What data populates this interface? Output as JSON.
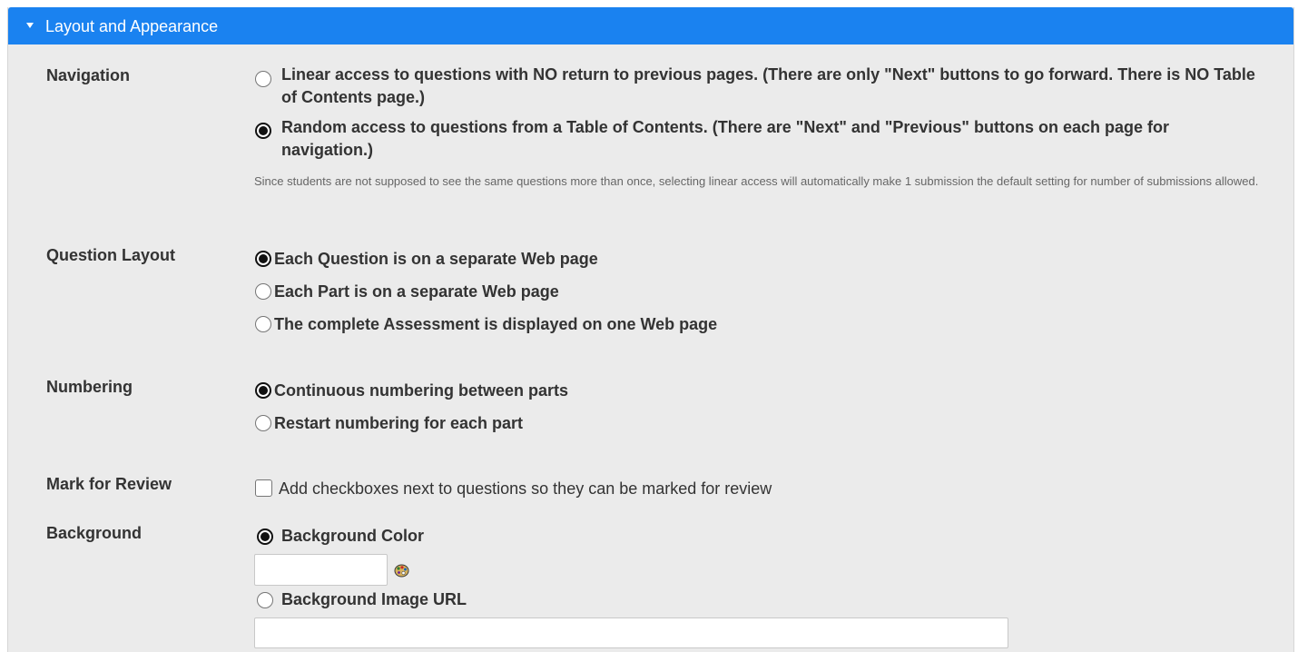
{
  "section": {
    "title": "Layout and Appearance",
    "caret_icon": "caret-down-icon",
    "header_color": "#1a82f0"
  },
  "navigation": {
    "label": "Navigation",
    "options": [
      {
        "label": "Linear access to questions with NO return to previous pages. (There are only \"Next\" buttons to go forward. There is NO Table of Contents page.)",
        "checked": false
      },
      {
        "label": "Random access to questions from a Table of Contents. (There are \"Next\" and \"Previous\" buttons on each page for navigation.)",
        "checked": true
      }
    ],
    "help": "Since students are not supposed to see the same questions more than once, selecting linear access will automatically make 1 submission the default setting for number of submissions allowed."
  },
  "question_layout": {
    "label": "Question Layout",
    "options": [
      {
        "label": "Each Question is on a separate Web page",
        "checked": true
      },
      {
        "label": "Each Part is on a separate Web page",
        "checked": false
      },
      {
        "label": "The complete Assessment is displayed on one Web page",
        "checked": false
      }
    ]
  },
  "numbering": {
    "label": "Numbering",
    "options": [
      {
        "label": "Continuous numbering between parts",
        "checked": true
      },
      {
        "label": "Restart numbering for each part",
        "checked": false
      }
    ]
  },
  "mark_for_review": {
    "label": "Mark for Review",
    "checkbox_label": "Add checkboxes next to questions so they can be marked for review",
    "checked": false
  },
  "background": {
    "label": "Background",
    "color_option": {
      "label": "Background Color",
      "checked": true,
      "value": ""
    },
    "palette_icon": "color-palette-icon",
    "image_option": {
      "label": "Background Image URL",
      "checked": false,
      "value": ""
    }
  }
}
